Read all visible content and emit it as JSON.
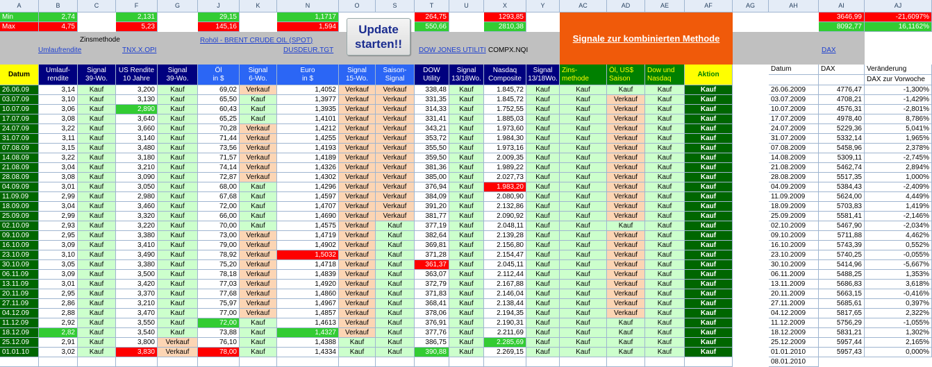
{
  "column_letters": [
    "A",
    "B",
    "C",
    "F",
    "G",
    "J",
    "K",
    "N",
    "O",
    "S",
    "T",
    "U",
    "X",
    "Y",
    "AC",
    "AD",
    "AE",
    "AF",
    "AG",
    "AH",
    "AI",
    "AJ"
  ],
  "summary": {
    "min_label": "Min",
    "max_label": "Max",
    "min": {
      "B": "2,74",
      "F": "2,131",
      "J": "29,15",
      "N": "1,1717",
      "T": "264,75",
      "X": "1293,85",
      "AI": "3646,99",
      "AJ": "-21,6097%"
    },
    "max": {
      "B": "4,75",
      "F": "5,23",
      "J": "145,16",
      "N": "1,594",
      "T": "550,66",
      "X": "2810,38",
      "AI": "8092,77",
      "AJ": "16,1162%"
    }
  },
  "zinsmethode_label": "Zinsmethode",
  "links": {
    "umlaufrendite": "Umlaufrendite",
    "tnx": "TNX.X.OPI",
    "brent": "Rohöl - BRENT CRUDE OIL (SPOT)",
    "dusdeur": "DUSDEUR.TGT",
    "dow": "DOW JONES UTILITI",
    "compx": "COMPX.NQI",
    "dax": "DAX"
  },
  "update_button": "Update starten!!",
  "signal_banner": "Signale zur kombinierten Methode",
  "colors": {
    "yellow": "#ffff00",
    "navy": "#00007f",
    "blue": "#2b66f5",
    "darkgreen": "#006600",
    "green": "#008000",
    "lightgreen": "#ccffcc",
    "orange": "#fcd5b4",
    "red": "#ff0000",
    "brightgreen": "#33cc33",
    "banner": "#f05a0a"
  },
  "headers": {
    "date": "Datum",
    "b": [
      "Umlauf-",
      "rendite"
    ],
    "c": [
      "Signal",
      "39-Wo."
    ],
    "f": [
      "US Rendite",
      "10 Jahre"
    ],
    "g": [
      "Signal",
      "39-Wo."
    ],
    "j": [
      "Öl",
      "in $"
    ],
    "k": [
      "Signal",
      "6-Wo."
    ],
    "n": [
      "Euro",
      "in $"
    ],
    "o": [
      "Signal",
      "15-Wo."
    ],
    "s": [
      "Saison-",
      "Signal"
    ],
    "t": [
      "DOW",
      "Utility"
    ],
    "u": [
      "Signal",
      "13/18Wo."
    ],
    "x": [
      "Nasdaq",
      "Composite"
    ],
    "y": [
      "Signal",
      "13/18Wo."
    ],
    "ac": [
      "Zins-",
      "methode"
    ],
    "ad": [
      "Öl, US$",
      "Saison"
    ],
    "ae": [
      "Dow und",
      "Nasdaq"
    ],
    "af": "Aktion",
    "ah": "Datum",
    "ai": "DAX",
    "aj": "Veränderung",
    "aj2": "DAX zur Vorwoche"
  },
  "rows": [
    [
      "26.06.09",
      "3,14",
      "Kauf",
      "3,200",
      "Kauf",
      "69,02",
      "Verkauf",
      "1,4052",
      "Verkauf",
      "Verkauf",
      "338,48",
      "Kauf",
      "1.845,72",
      "Kauf",
      "Kauf",
      "Kauf",
      "Kauf",
      "Kauf"
    ],
    [
      "03.07.09",
      "3,10",
      "Kauf",
      "3,130",
      "Kauf",
      "65,50",
      "Kauf",
      "1,3977",
      "Verkauf",
      "Verkauf",
      "331,35",
      "Kauf",
      "1.845,72",
      "Kauf",
      "Kauf",
      "Verkauf",
      "Kauf",
      "Kauf"
    ],
    [
      "10.07.09",
      "3,06",
      "Kauf",
      "2,890",
      "Kauf",
      "60,43",
      "Kauf",
      "1,3935",
      "Verkauf",
      "Verkauf",
      "314,33",
      "Kauf",
      "1.752,55",
      "Kauf",
      "Kauf",
      "Verkauf",
      "Kauf",
      "Kauf"
    ],
    [
      "17.07.09",
      "3,08",
      "Kauf",
      "3,640",
      "Kauf",
      "65,25",
      "Kauf",
      "1,4101",
      "Verkauf",
      "Verkauf",
      "331,41",
      "Kauf",
      "1.885,03",
      "Kauf",
      "Kauf",
      "Verkauf",
      "Kauf",
      "Kauf"
    ],
    [
      "24.07.09",
      "3,22",
      "Kauf",
      "3,660",
      "Kauf",
      "70,28",
      "Verkauf",
      "1,4212",
      "Verkauf",
      "Verkauf",
      "343,21",
      "Kauf",
      "1.973,60",
      "Kauf",
      "Kauf",
      "Verkauf",
      "Kauf",
      "Kauf"
    ],
    [
      "31.07.09",
      "3,11",
      "Kauf",
      "3,140",
      "Kauf",
      "71,44",
      "Verkauf",
      "1,4255",
      "Verkauf",
      "Verkauf",
      "353,72",
      "Kauf",
      "1.984,30",
      "Kauf",
      "Kauf",
      "Verkauf",
      "Kauf",
      "Kauf"
    ],
    [
      "07.08.09",
      "3,15",
      "Kauf",
      "3,480",
      "Kauf",
      "73,56",
      "Verkauf",
      "1,4193",
      "Verkauf",
      "Verkauf",
      "355,50",
      "Kauf",
      "1.973,16",
      "Kauf",
      "Kauf",
      "Verkauf",
      "Kauf",
      "Kauf"
    ],
    [
      "14.08.09",
      "3,22",
      "Kauf",
      "3,180",
      "Kauf",
      "71,57",
      "Verkauf",
      "1,4189",
      "Verkauf",
      "Verkauf",
      "359,50",
      "Kauf",
      "2.009,35",
      "Kauf",
      "Kauf",
      "Verkauf",
      "Kauf",
      "Kauf"
    ],
    [
      "21.08.09",
      "3,04",
      "Kauf",
      "3,210",
      "Kauf",
      "74,14",
      "Verkauf",
      "1,4326",
      "Verkauf",
      "Verkauf",
      "381,36",
      "Kauf",
      "1.989,22",
      "Kauf",
      "Kauf",
      "Verkauf",
      "Kauf",
      "Kauf"
    ],
    [
      "28.08.09",
      "3,08",
      "Kauf",
      "3,090",
      "Kauf",
      "72,87",
      "Verkauf",
      "1,4302",
      "Verkauf",
      "Verkauf",
      "385,00",
      "Kauf",
      "2.027,73",
      "Kauf",
      "Kauf",
      "Verkauf",
      "Kauf",
      "Kauf"
    ],
    [
      "04.09.09",
      "3,01",
      "Kauf",
      "3,050",
      "Kauf",
      "68,00",
      "Kauf",
      "1,4296",
      "Verkauf",
      "Verkauf",
      "376,94",
      "Kauf",
      "1.983,20",
      "Kauf",
      "Kauf",
      "Verkauf",
      "Kauf",
      "Kauf"
    ],
    [
      "11.09.09",
      "2,99",
      "Kauf",
      "2,980",
      "Kauf",
      "67,68",
      "Kauf",
      "1,4597",
      "Verkauf",
      "Verkauf",
      "384,09",
      "Kauf",
      "2.080,90",
      "Kauf",
      "Kauf",
      "Verkauf",
      "Kauf",
      "Kauf"
    ],
    [
      "18.09.09",
      "3,04",
      "Kauf",
      "3,460",
      "Kauf",
      "72,00",
      "Kauf",
      "1,4707",
      "Verkauf",
      "Verkauf",
      "391,20",
      "Kauf",
      "2.132,86",
      "Kauf",
      "Kauf",
      "Verkauf",
      "Kauf",
      "Kauf"
    ],
    [
      "25.09.09",
      "2,99",
      "Kauf",
      "3,320",
      "Kauf",
      "66,00",
      "Kauf",
      "1,4690",
      "Verkauf",
      "Verkauf",
      "381,77",
      "Kauf",
      "2.090,92",
      "Kauf",
      "Kauf",
      "Verkauf",
      "Kauf",
      "Kauf"
    ],
    [
      "02.10.09",
      "2,93",
      "Kauf",
      "3,220",
      "Kauf",
      "70,00",
      "Kauf",
      "1,4575",
      "Verkauf",
      "Kauf",
      "377,19",
      "Kauf",
      "2.048,11",
      "Kauf",
      "Kauf",
      "Kauf",
      "Kauf",
      "Kauf"
    ],
    [
      "09.10.09",
      "2,95",
      "Kauf",
      "3,380",
      "Kauf",
      "73,00",
      "Verkauf",
      "1,4719",
      "Verkauf",
      "Kauf",
      "382,64",
      "Kauf",
      "2.139,28",
      "Kauf",
      "Kauf",
      "Verkauf",
      "Kauf",
      "Kauf"
    ],
    [
      "16.10.09",
      "3,09",
      "Kauf",
      "3,410",
      "Kauf",
      "79,00",
      "Verkauf",
      "1,4902",
      "Verkauf",
      "Kauf",
      "369,81",
      "Kauf",
      "2.156,80",
      "Kauf",
      "Kauf",
      "Verkauf",
      "Kauf",
      "Kauf"
    ],
    [
      "23.10.09",
      "3,10",
      "Kauf",
      "3,490",
      "Kauf",
      "78,92",
      "Verkauf",
      "1,5032",
      "Verkauf",
      "Kauf",
      "371,28",
      "Kauf",
      "2.154,47",
      "Kauf",
      "Kauf",
      "Verkauf",
      "Kauf",
      "Kauf"
    ],
    [
      "30.10.09",
      "3,05",
      "Kauf",
      "3,380",
      "Kauf",
      "75,20",
      "Verkauf",
      "1,4718",
      "Verkauf",
      "Kauf",
      "361,37",
      "Kauf",
      "2.045,11",
      "Kauf",
      "Kauf",
      "Verkauf",
      "Kauf",
      "Kauf"
    ],
    [
      "06.11.09",
      "3,09",
      "Kauf",
      "3,500",
      "Kauf",
      "78,18",
      "Verkauf",
      "1,4839",
      "Verkauf",
      "Kauf",
      "363,07",
      "Kauf",
      "2.112,44",
      "Kauf",
      "Kauf",
      "Verkauf",
      "Kauf",
      "Kauf"
    ],
    [
      "13.11.09",
      "3,01",
      "Kauf",
      "3,420",
      "Kauf",
      "77,03",
      "Verkauf",
      "1,4920",
      "Verkauf",
      "Kauf",
      "372,79",
      "Kauf",
      "2.167,88",
      "Kauf",
      "Kauf",
      "Verkauf",
      "Kauf",
      "Kauf"
    ],
    [
      "20.11.09",
      "2,95",
      "Kauf",
      "3,370",
      "Kauf",
      "77,68",
      "Verkauf",
      "1,4860",
      "Verkauf",
      "Kauf",
      "371,83",
      "Kauf",
      "2.146,04",
      "Kauf",
      "Kauf",
      "Verkauf",
      "Kauf",
      "Kauf"
    ],
    [
      "27.11.09",
      "2,86",
      "Kauf",
      "3,210",
      "Kauf",
      "75,97",
      "Verkauf",
      "1,4967",
      "Verkauf",
      "Kauf",
      "368,41",
      "Kauf",
      "2.138,44",
      "Kauf",
      "Kauf",
      "Verkauf",
      "Kauf",
      "Kauf"
    ],
    [
      "04.12.09",
      "2,88",
      "Kauf",
      "3,470",
      "Kauf",
      "77,00",
      "Verkauf",
      "1,4857",
      "Verkauf",
      "Kauf",
      "378,06",
      "Kauf",
      "2.194,35",
      "Kauf",
      "Kauf",
      "Verkauf",
      "Kauf",
      "Kauf"
    ],
    [
      "11.12.09",
      "2,92",
      "Kauf",
      "3,550",
      "Kauf",
      "72,00",
      "Kauf",
      "1,4613",
      "Verkauf",
      "Kauf",
      "376,91",
      "Kauf",
      "2.190,31",
      "Kauf",
      "Kauf",
      "Kauf",
      "Kauf",
      "Kauf"
    ],
    [
      "18.12.09",
      "2,82",
      "Kauf",
      "3,540",
      "Kauf",
      "73,88",
      "Kauf",
      "1,4327",
      "Verkauf",
      "Kauf",
      "377,76",
      "Kauf",
      "2.211,69",
      "Kauf",
      "Kauf",
      "Kauf",
      "Kauf",
      "Kauf"
    ],
    [
      "25.12.09",
      "2,91",
      "Kauf",
      "3,800",
      "Verkauf",
      "76,10",
      "Kauf",
      "1,4388",
      "Kauf",
      "Kauf",
      "386,75",
      "Kauf",
      "2.285,69",
      "Kauf",
      "Kauf",
      "Kauf",
      "Kauf",
      "Kauf"
    ],
    [
      "01.01.10",
      "3,02",
      "Kauf",
      "3,830",
      "Verkauf",
      "78,00",
      "Kauf",
      "1,4334",
      "Kauf",
      "Kauf",
      "390,88",
      "Kauf",
      "2.269,15",
      "Kauf",
      "Kauf",
      "Kauf",
      "Kauf",
      "Kauf"
    ]
  ],
  "dax_rows": [
    [
      "26.06.2009",
      "4776,47",
      "-1,300%"
    ],
    [
      "03.07.2009",
      "4708,21",
      "-1,429%"
    ],
    [
      "10.07.2009",
      "4576,31",
      "-2,801%"
    ],
    [
      "17.07.2009",
      "4978,40",
      "8,786%"
    ],
    [
      "24.07.2009",
      "5229,36",
      "5,041%"
    ],
    [
      "31.07.2009",
      "5332,14",
      "1,965%"
    ],
    [
      "07.08.2009",
      "5458,96",
      "2,378%"
    ],
    [
      "14.08.2009",
      "5309,11",
      "-2,745%"
    ],
    [
      "21.08.2009",
      "5462,74",
      "2,894%"
    ],
    [
      "28.08.2009",
      "5517,35",
      "1,000%"
    ],
    [
      "04.09.2009",
      "5384,43",
      "-2,409%"
    ],
    [
      "11.09.2009",
      "5624,00",
      "4,449%"
    ],
    [
      "18.09.2009",
      "5703,83",
      "1,419%"
    ],
    [
      "25.09.2009",
      "5581,41",
      "-2,146%"
    ],
    [
      "02.10.2009",
      "5467,90",
      "-2,034%"
    ],
    [
      "09.10.2009",
      "5711,88",
      "4,462%"
    ],
    [
      "16.10.2009",
      "5743,39",
      "0,552%"
    ],
    [
      "23.10.2009",
      "5740,25",
      "-0,055%"
    ],
    [
      "30.10.2009",
      "5414,96",
      "-5,667%"
    ],
    [
      "06.11.2009",
      "5488,25",
      "1,353%"
    ],
    [
      "13.11.2009",
      "5686,83",
      "3,618%"
    ],
    [
      "20.11.2009",
      "5663,15",
      "-0,416%"
    ],
    [
      "27.11.2009",
      "5685,61",
      "0,397%"
    ],
    [
      "04.12.2009",
      "5817,65",
      "2,322%"
    ],
    [
      "11.12.2009",
      "5756,29",
      "-1,055%"
    ],
    [
      "18.12.2009",
      "5831,21",
      "1,302%"
    ],
    [
      "25.12.2009",
      "5957,44",
      "2,165%"
    ],
    [
      "01.01.2010",
      "5957,43",
      "0,000%"
    ]
  ],
  "dax_last_date": "08.01.2010"
}
